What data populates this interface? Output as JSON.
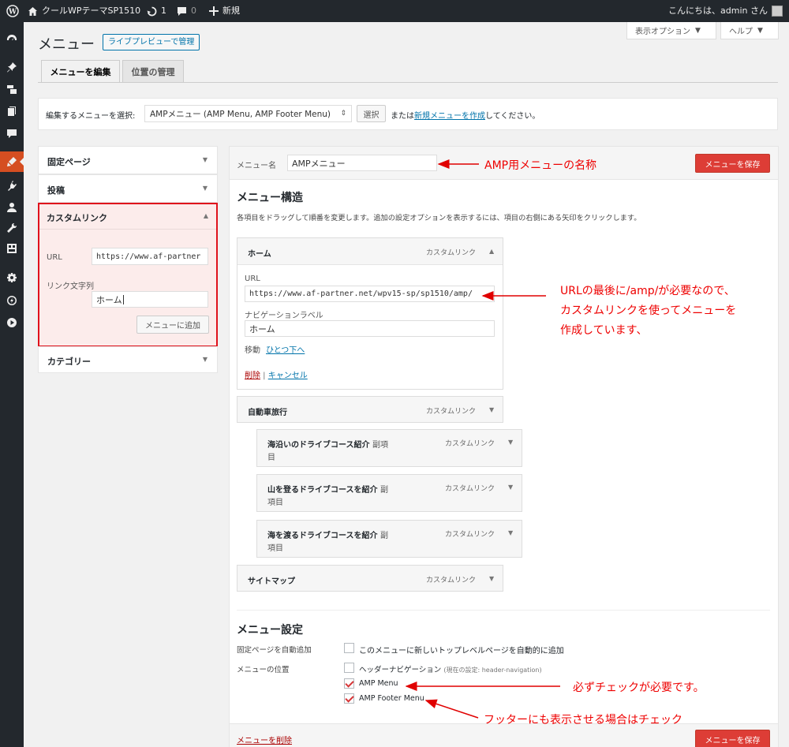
{
  "adminbar": {
    "site_name": "クールWPテーマSP1510",
    "updates": "1",
    "comments": "0",
    "new": "新規",
    "greeting": "こんにちは、admin さん"
  },
  "screen_options": {
    "display_options": "表示オプション",
    "help": "ヘルプ"
  },
  "page": {
    "title": "メニュー",
    "live_preview": "ライブプレビューで管理"
  },
  "tabs": [
    {
      "label": "メニューを編集"
    },
    {
      "label": "位置の管理"
    }
  ],
  "menu_select": {
    "label": "編集するメニューを選択:",
    "value": "AMPメニュー (AMP Menu, AMP Footer Menu)",
    "select_button": "選択",
    "or_text": "または",
    "create_link": "新規メニューを作成",
    "suffix": "してください。"
  },
  "accordion": {
    "fixed_pages": "固定ページ",
    "posts": "投稿",
    "custom_links": "カスタムリンク",
    "url_label": "URL",
    "url_value": "https://www.af-partner",
    "link_text_label": "リンク文字列",
    "link_text_value": "ホーム",
    "add_button": "メニューに追加",
    "categories": "カテゴリー"
  },
  "menu_edit": {
    "name_label": "メニュー名",
    "name_value": "AMPメニュー",
    "save_button": "メニューを保存",
    "structure_title": "メニュー構造",
    "structure_desc": "各項目をドラッグして順番を変更します。追加の設定オプションを表示するには、項目の右側にある矢印をクリックします。"
  },
  "items": {
    "home": {
      "label": "ホーム",
      "type": "カスタムリンク"
    },
    "home_fields": {
      "url_label": "URL",
      "url_value": "https://www.af-partner.net/wpv15-sp/sp1510/amp/",
      "nav_label": "ナビゲーションラベル",
      "nav_value": "ホーム",
      "move_label": "移動",
      "move_link": "ひとつ下へ",
      "delete": "削除",
      "sep": " | ",
      "cancel": "キャンセル"
    },
    "car": {
      "label": "自動車旅行",
      "type": "カスタムリンク"
    },
    "sub1": {
      "label": "海沿いのドライブコース紹介",
      "sub_a": "副項",
      "sub_b": "目",
      "type": "カスタムリンク"
    },
    "sub2": {
      "label": "山を登るドライブコースを紹介",
      "sub_a": "副",
      "sub_b": "項目",
      "type": "カスタムリンク"
    },
    "sub3": {
      "label": "海を渡るドライブコースを紹介",
      "sub_a": "副",
      "sub_b": "項目",
      "type": "カスタムリンク"
    },
    "sitemap": {
      "label": "サイトマップ",
      "type": "カスタムリンク"
    }
  },
  "settings": {
    "title": "メニュー設定",
    "auto_add_label": "固定ページを自動追加",
    "auto_add_text": "このメニューに新しいトップレベルページを自動的に追加",
    "position_label": "メニューの位置",
    "header_nav": "ヘッダーナビゲーション",
    "header_nav_note": "(現在の設定: header-navigation)",
    "amp_menu": "AMP Menu",
    "amp_footer_menu": "AMP Footer Menu",
    "delete_menu": "メニューを削除",
    "save_button": "メニューを保存"
  },
  "checks": {
    "auto_add": false,
    "header_nav": false,
    "amp_menu": true,
    "amp_footer_menu": true
  },
  "annotations": {
    "name_note": "AMP用メニューの名称",
    "url_note_1": "URLの最後に/amp/が必要なので、",
    "url_note_2": "カスタムリンクを使ってメニューを",
    "url_note_3": "作成しています、",
    "check_note": "必ずチェックが必要です。",
    "footer_note": "フッターにも表示させる場合はチェック"
  },
  "colors": {
    "adminbar": "#23282d",
    "accent_red": "#dd3d36",
    "annotation_red": "#e00000",
    "link_blue": "#0073aa"
  }
}
